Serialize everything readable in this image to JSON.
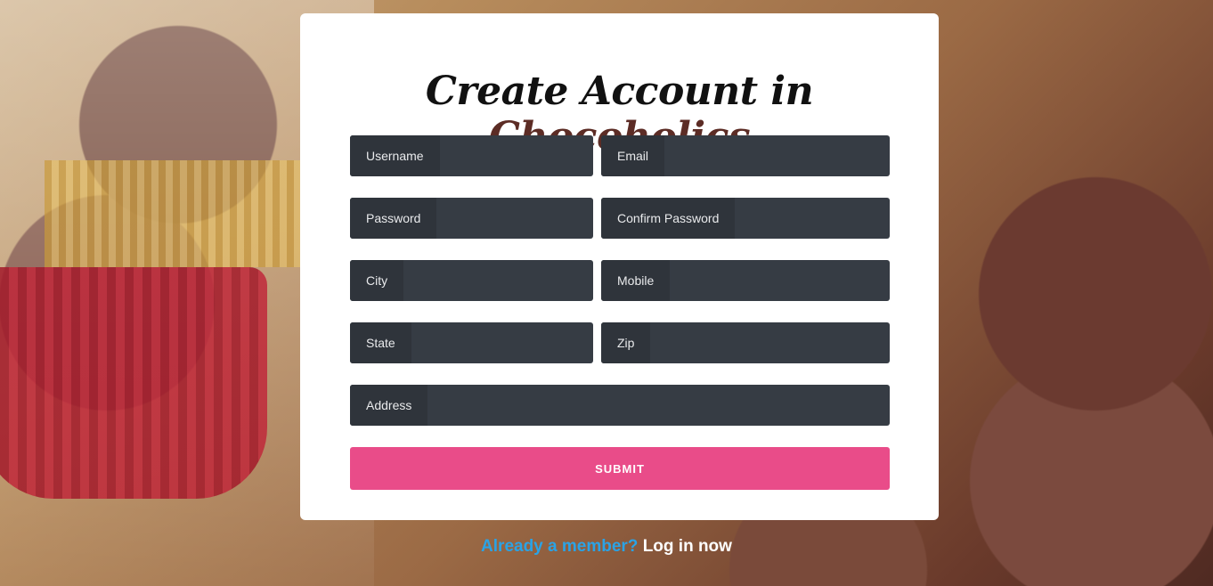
{
  "form": {
    "title_prefix": "Create Account in",
    "title_brand": "Chocoholics",
    "fields": {
      "username": "Username",
      "email": "Email",
      "password": "Password",
      "confirm_password": "Confirm Password",
      "city": "City",
      "mobile": "Mobile",
      "state": "State",
      "zip": "Zip",
      "address": "Address"
    },
    "submit_label": "SUBMIT"
  },
  "footer": {
    "question": "Already a member?",
    "login_link": "Log in now"
  },
  "colors": {
    "submit": "#e94c89",
    "field_bg": "#363c44",
    "brand_text": "#5c2c25",
    "question_text": "#2aa3e6"
  }
}
